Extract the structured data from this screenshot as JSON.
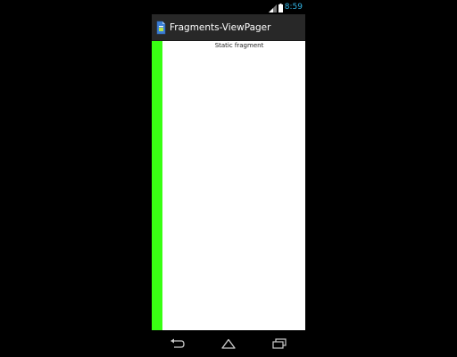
{
  "status_bar": {
    "time": "8:59",
    "icons": [
      "signal-icon",
      "battery-icon"
    ]
  },
  "action_bar": {
    "app_icon": "app-launcher-icon",
    "title": "Fragments-ViewPager"
  },
  "content": {
    "fragment_label": "Static fragment",
    "strip_color": "#39ff13"
  },
  "nav_bar": {
    "buttons": [
      "back-icon",
      "home-icon",
      "recent-apps-icon"
    ]
  },
  "colors": {
    "status_time": "#33b5e5",
    "action_bar_bg": "#282828",
    "green_strip": "#39ff13"
  }
}
